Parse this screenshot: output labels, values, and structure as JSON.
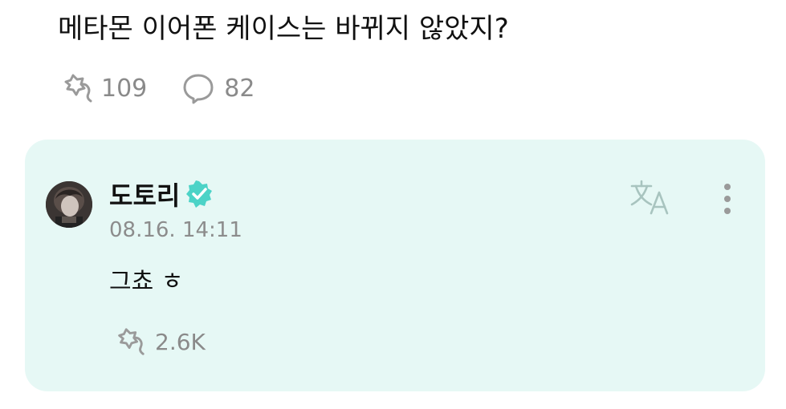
{
  "post": {
    "text": "메타몬 이어폰 케이스는 바뀌지 않았지?",
    "like_count": "109",
    "comment_count": "82"
  },
  "comment": {
    "author": "도토리",
    "timestamp": "08.16. 14:11",
    "body": "그쵸 ㅎ",
    "like_count": "2.6K"
  },
  "icons": {
    "like": "like-icon",
    "comment": "comment-bubble-icon",
    "verified": "verified-badge-icon",
    "translate": "translate-icon",
    "more": "more-vertical-icon"
  },
  "colors": {
    "card_background": "#e6f8f5",
    "verified": "#4cd3c7",
    "muted_text": "#8a8a8a",
    "icon_gray": "#9a9a9a"
  }
}
